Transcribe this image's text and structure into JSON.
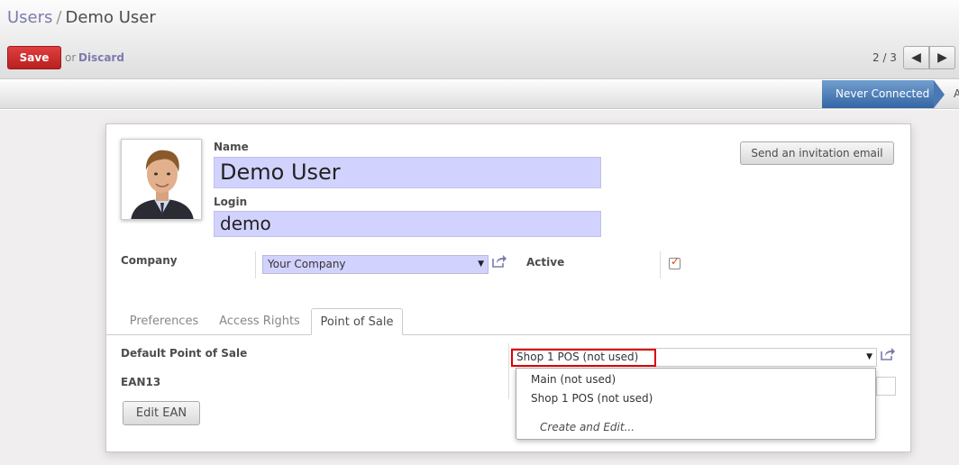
{
  "breadcrumb": {
    "parent": "Users",
    "separator": "/",
    "current": "Demo User"
  },
  "toolbar": {
    "save_label": "Save",
    "or_text": "or",
    "discard_label": "Discard"
  },
  "pager": {
    "text": "2 / 3",
    "prev_icon": "arrow-left-icon",
    "next_icon": "arrow-right-icon"
  },
  "statusbar": {
    "active_stage": "Never Connected",
    "next_stage_partial": "A"
  },
  "form": {
    "name_label": "Name",
    "name_value": "Demo User",
    "login_label": "Login",
    "login_value": "demo",
    "invite_button": "Send an invitation email",
    "company_label": "Company",
    "company_value": "Your Company",
    "active_label": "Active",
    "active_checked": true
  },
  "tabs": [
    {
      "label": "Preferences",
      "active": false
    },
    {
      "label": "Access Rights",
      "active": false
    },
    {
      "label": "Point of Sale",
      "active": true
    }
  ],
  "pos_tab": {
    "default_pos_label": "Default Point of Sale",
    "default_pos_value": "Shop 1 POS (not used)",
    "ean13_label": "EAN13",
    "edit_ean_button": "Edit EAN",
    "dropdown_options": [
      "Main (not used)",
      "Shop 1 POS (not used)"
    ],
    "dropdown_create": "Create and Edit..."
  },
  "colors": {
    "accent": "#7c7bad",
    "save": "#c62828",
    "stage": "#3465a4",
    "field_required": "#d2d2ff",
    "highlight_box": "#dd0000"
  }
}
